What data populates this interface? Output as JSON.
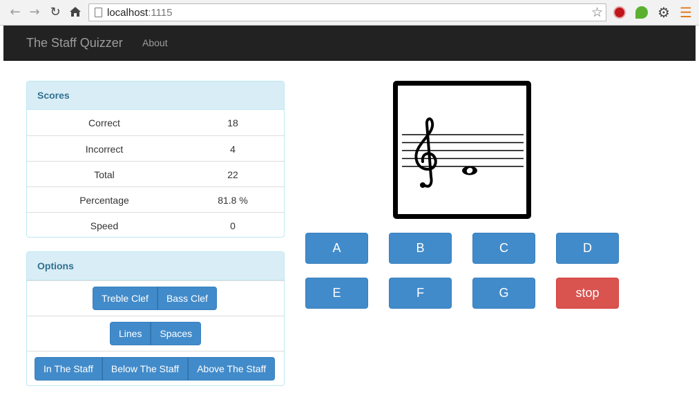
{
  "browser": {
    "url_host": "localhost",
    "url_port": ":1115",
    "icons": [
      "back-icon",
      "forward-icon",
      "reload-icon",
      "home-icon",
      "page-icon",
      "star-icon",
      "adblock-icon",
      "evernote-icon",
      "settings-icon",
      "menu-icon"
    ]
  },
  "navbar": {
    "brand": "The Staff Quizzer",
    "links": [
      "About"
    ]
  },
  "scores": {
    "heading": "Scores",
    "rows": [
      {
        "label": "Correct",
        "value": "18"
      },
      {
        "label": "Incorrect",
        "value": "4"
      },
      {
        "label": "Total",
        "value": "22"
      },
      {
        "label": "Percentage",
        "value": "81.8 %"
      },
      {
        "label": "Speed",
        "value": "0"
      }
    ]
  },
  "options": {
    "heading": "Options",
    "clef": [
      "Treble Clef",
      "Bass Clef"
    ],
    "position": [
      "Lines",
      "Spaces"
    ],
    "range": [
      "In The Staff",
      "Below The Staff",
      "Above The Staff"
    ]
  },
  "answers": {
    "row1": [
      "A",
      "B",
      "C",
      "D"
    ],
    "row2": [
      "E",
      "F",
      "G"
    ],
    "stop": "stop"
  },
  "colors": {
    "primary": "#428bca",
    "danger": "#d9534f",
    "navbar": "#222222",
    "panel_heading": "#d9edf7"
  }
}
